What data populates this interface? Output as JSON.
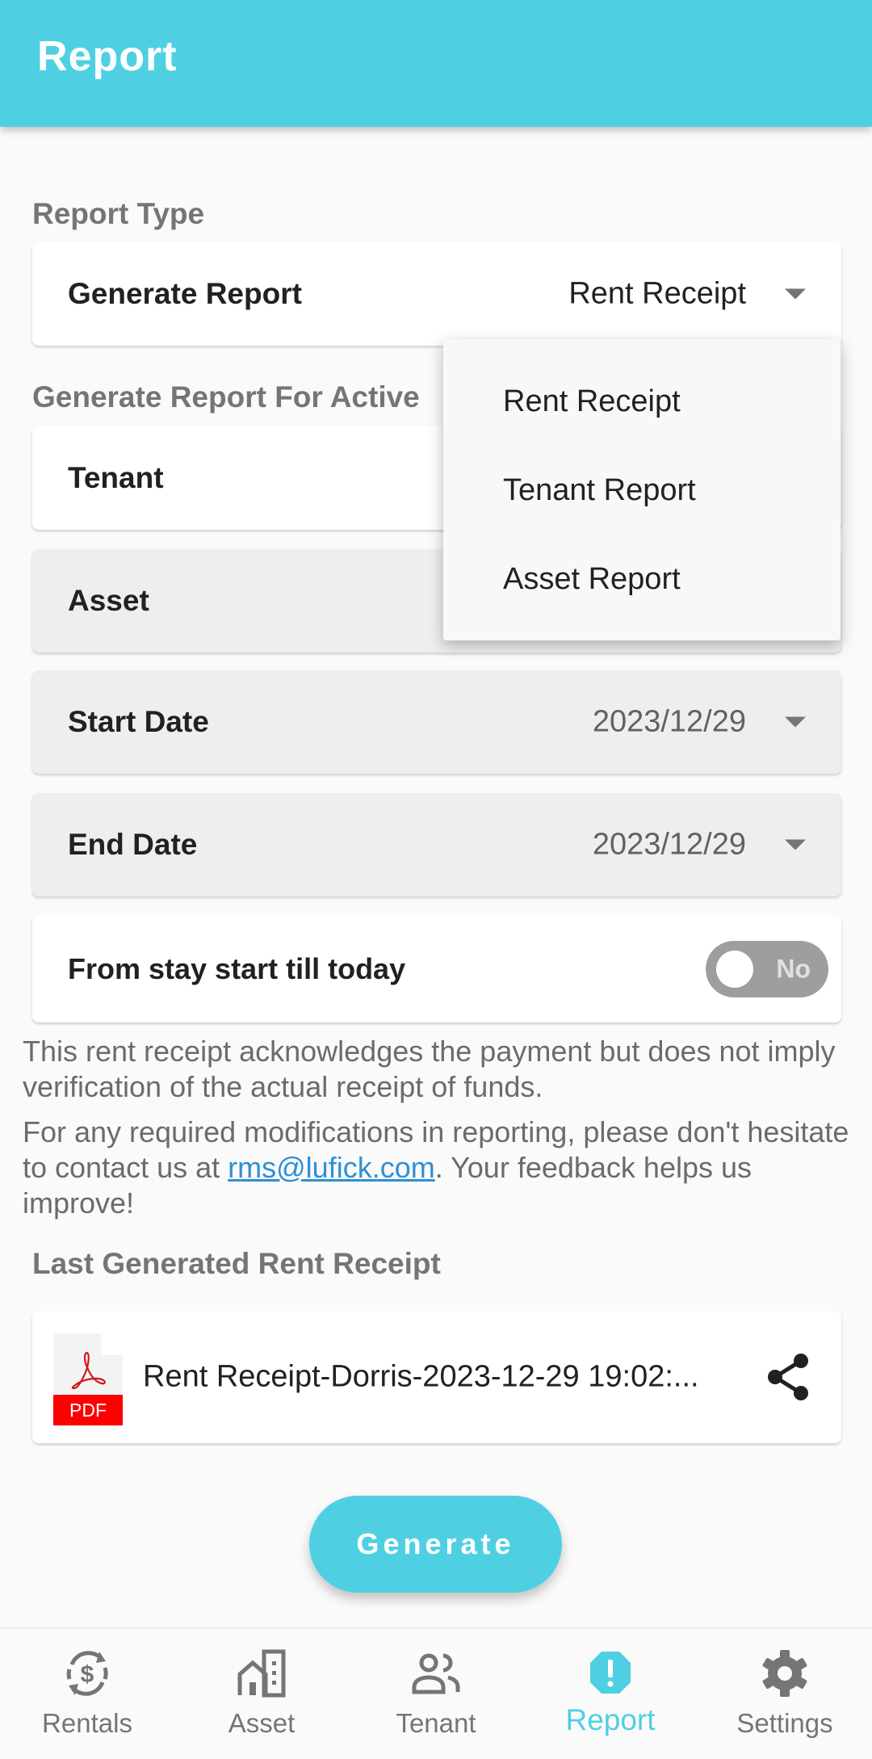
{
  "appbar": {
    "title": "Report"
  },
  "report_type": {
    "section_label": "Report Type",
    "field_label": "Generate Report",
    "selected_value": "Rent Receipt",
    "options": [
      "Rent Receipt",
      "Tenant Report",
      "Asset Report"
    ]
  },
  "active_section": {
    "label": "Generate Report For Active",
    "tenant_label": "Tenant",
    "asset_label": "Asset"
  },
  "dates": {
    "start_label": "Start Date",
    "start_value": "2023/12/29",
    "end_label": "End Date",
    "end_value": "2023/12/29"
  },
  "stay_toggle": {
    "label": "From stay start till today",
    "state_text": "No"
  },
  "info": {
    "disclaimer": "This rent receipt acknowledges the payment but does not imply verification of the actual receipt of funds.",
    "contact_prefix": "For any required modifications in reporting, please don't hesitate to contact us at ",
    "contact_email": "rms@lufick.com",
    "contact_suffix": ". Your feedback helps us improve!"
  },
  "last_generated": {
    "label": "Last Generated Rent Receipt",
    "file_name": "Rent Receipt-Dorris-2023-12-29 19:02:...",
    "file_badge": "PDF"
  },
  "generate_button": "Generate",
  "bottom_nav": {
    "active": "Report",
    "accent_color": "#4fd0e2",
    "items": [
      {
        "label": "Rentals",
        "icon": "currency-exchange-icon"
      },
      {
        "label": "Asset",
        "icon": "buildings-icon"
      },
      {
        "label": "Tenant",
        "icon": "people-icon"
      },
      {
        "label": "Report",
        "icon": "report-alert-icon"
      },
      {
        "label": "Settings",
        "icon": "gear-icon"
      }
    ]
  }
}
